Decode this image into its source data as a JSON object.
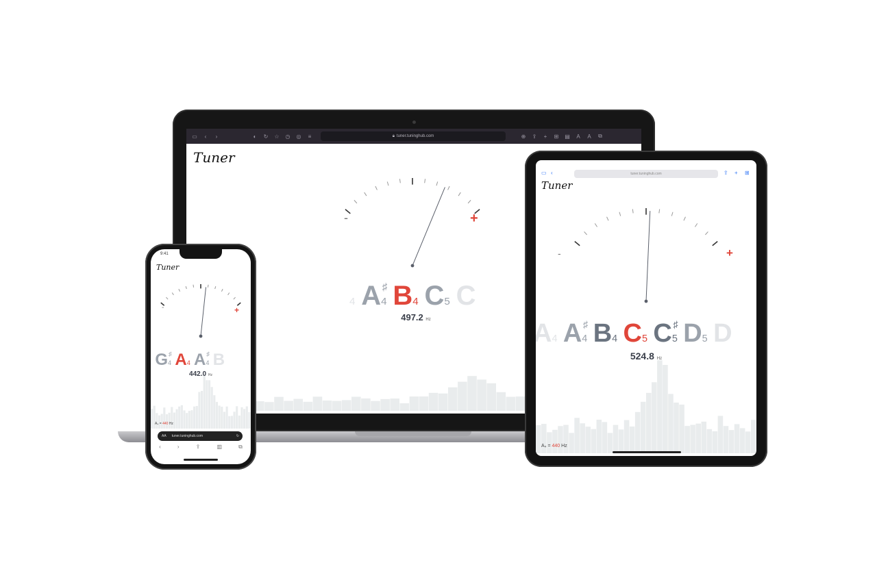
{
  "laptop": {
    "url": "tuner.tuninghub.com",
    "logo": "Tuner",
    "minus": "-",
    "plus": "+",
    "notes": [
      {
        "letter": "",
        "acc": "",
        "oct": "4",
        "state": "faded"
      },
      {
        "letter": "A",
        "acc": "♯",
        "oct": "4",
        "state": "neighbor"
      },
      {
        "letter": "B",
        "acc": "",
        "oct": "4",
        "state": "active"
      },
      {
        "letter": "C",
        "acc": "",
        "oct": "5",
        "state": "neighbor"
      },
      {
        "letter": "C",
        "acc": "",
        "oct": "",
        "state": "faded"
      }
    ],
    "freq_value": "497.2",
    "freq_unit": "Hz",
    "needle_deviation": 0.45
  },
  "tablet": {
    "url": "tuner.tuninghub.com",
    "logo": "Tuner",
    "minus": "-",
    "plus": "+",
    "notes": [
      {
        "letter": "A",
        "acc": "",
        "oct": "4",
        "state": "faded"
      },
      {
        "letter": "A",
        "acc": "♯",
        "oct": "4",
        "state": "neighbor"
      },
      {
        "letter": "B",
        "acc": "",
        "oct": "4",
        "state": "neighbor-dark"
      },
      {
        "letter": "C",
        "acc": "",
        "oct": "5",
        "state": "active"
      },
      {
        "letter": "C",
        "acc": "♯",
        "oct": "5",
        "state": "neighbor-dark"
      },
      {
        "letter": "D",
        "acc": "",
        "oct": "5",
        "state": "neighbor"
      },
      {
        "letter": "D",
        "acc": "",
        "oct": "",
        "state": "faded"
      }
    ],
    "freq_value": "524.8",
    "freq_unit": "Hz",
    "ref_label": "A₄ =",
    "ref_value": "440",
    "ref_unit": "Hz",
    "needle_deviation": 0.05
  },
  "phone": {
    "time": "9:41",
    "url": "tuner.tuninghub.com",
    "logo": "Tuner",
    "minus": "-",
    "plus": "+",
    "notes": [
      {
        "letter": "",
        "acc": "",
        "oct": "4",
        "state": "faded"
      },
      {
        "letter": "G",
        "acc": "♯",
        "oct": "4",
        "state": "neighbor"
      },
      {
        "letter": "A",
        "acc": "",
        "oct": "4",
        "state": "active"
      },
      {
        "letter": "A",
        "acc": "♯",
        "oct": "4",
        "state": "neighbor"
      },
      {
        "letter": "B",
        "acc": "",
        "oct": "",
        "state": "faded"
      }
    ],
    "freq_value": "442.0",
    "freq_unit": "Hz",
    "ref_label": "A₄ =",
    "ref_value": "440",
    "ref_unit": "Hz",
    "url_prefix": "AA",
    "needle_deviation": 0.12
  },
  "colors": {
    "active": "#e0463a",
    "neighbor": "#9ba2ab",
    "neighbor_dark": "#6b7480",
    "faded": "#e2e4e7",
    "spectrum": "#e9eced"
  }
}
